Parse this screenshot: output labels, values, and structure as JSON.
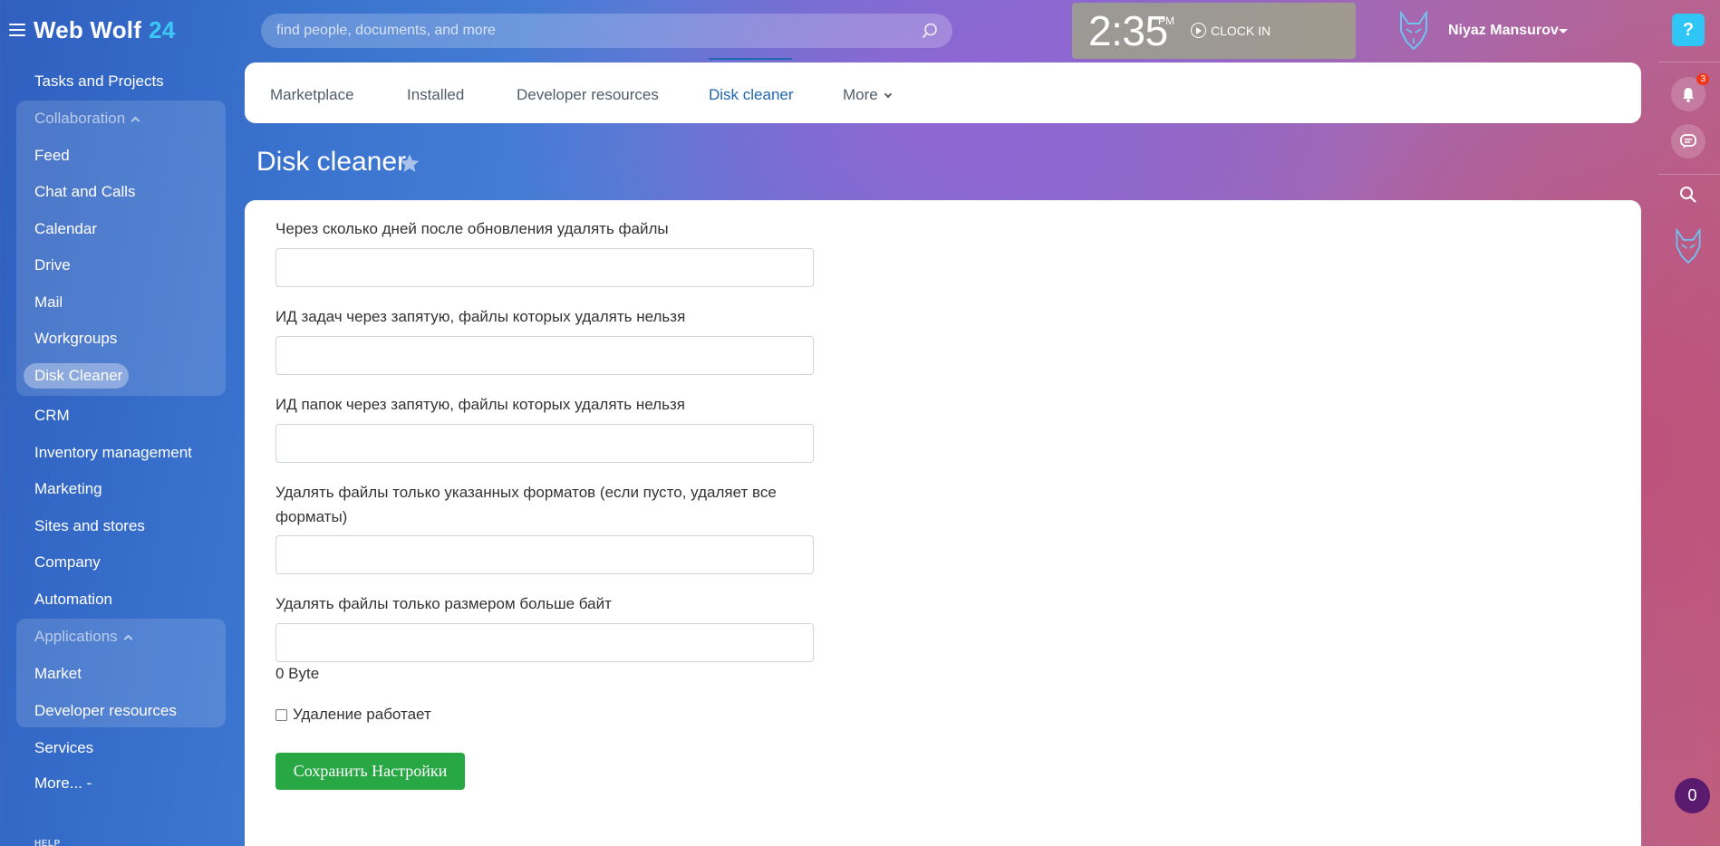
{
  "header": {
    "logo_text": "Web Wolf",
    "logo_num": "24",
    "search_placeholder": "find people, documents, and more",
    "clock_time": "2:35",
    "clock_ampm": "PM",
    "clock_in_label": "CLOCK IN",
    "user_name": "Niyaz Mansurov"
  },
  "right_rail": {
    "help_label": "?",
    "notifications_count": "3",
    "chat_count": "0"
  },
  "left_menu": {
    "tasks": "Tasks and Projects",
    "collaboration_title": "Collaboration",
    "collaboration_items": [
      "Feed",
      "Chat and Calls",
      "Calendar",
      "Drive",
      "Mail",
      "Workgroups",
      "Disk Cleaner"
    ],
    "crm": "CRM",
    "inventory": "Inventory management",
    "marketing": "Marketing",
    "sites": "Sites and stores",
    "company": "Company",
    "automation": "Automation",
    "applications_title": "Applications",
    "applications_items": [
      "Market",
      "Developer resources"
    ],
    "services": "Services",
    "more": "More... -",
    "help": "HELP"
  },
  "tabs": [
    "Marketplace",
    "Installed",
    "Developer resources",
    "Disk cleaner",
    "More"
  ],
  "page": {
    "title": "Disk cleaner"
  },
  "form": {
    "label_days": "Через сколько дней после обновления удалять файлы",
    "label_task_ids": "ИД задач через запятую, файлы которых удалять нельзя",
    "label_folder_ids": "ИД папок через запятую, файлы которых удалять нельзя",
    "label_formats": "Удалять файлы только указанных форматов (если пусто, удаляет все форматы)",
    "label_size": "Удалять файлы только размером больше байт",
    "size_readout": "0 Byte",
    "checkbox_label": "Удаление работает",
    "checkbox_checked": false,
    "save_label": "Сохранить Настройки"
  },
  "colors": {
    "accent": "#2067b0",
    "save_button": "#28a745",
    "help_button": "#2fc6f6",
    "badge": "#f0371b"
  }
}
